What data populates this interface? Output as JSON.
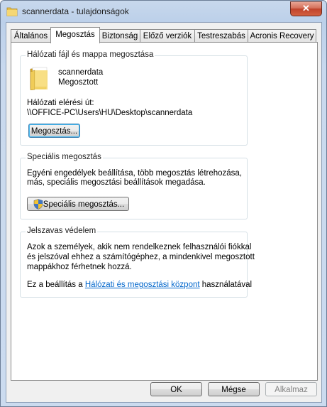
{
  "window": {
    "title": "scannerdata - tulajdonságok",
    "close_label": "✕"
  },
  "tabs": [
    {
      "label": "Általános"
    },
    {
      "label": "Megosztás",
      "active": true
    },
    {
      "label": "Biztonság"
    },
    {
      "label": "Előző verziók"
    },
    {
      "label": "Testreszabás"
    },
    {
      "label": "Acronis Recovery"
    }
  ],
  "network_sharing": {
    "title": "Hálózati fájl és mappa megosztása",
    "folder_name": "scannerdata",
    "status": "Megosztott",
    "path_label": "Hálózati elérési út:",
    "path": "\\\\OFFICE-PC\\Users\\HU\\Desktop\\scannerdata",
    "share_button": "Megosztás..."
  },
  "advanced_sharing": {
    "title": "Speciális megosztás",
    "description_line1": "Egyéni engedélyek beállítása, több megosztás létrehozása,",
    "description_line2": "más, speciális megosztási beállítások megadása.",
    "button": "Speciális megosztás..."
  },
  "password_protection": {
    "title": "Jelszavas védelem",
    "line1": "Azok a személyek, akik nem rendelkeznek felhasználói fiókkal",
    "line2": "és jelszóval ehhez a számítógéphez, a mindenkivel megosztott",
    "line3": "mappákhoz férhetnek hozzá.",
    "settings_prefix": "Ez a beállítás a",
    "settings_link": "Hálózati és megosztási központ",
    "settings_suffix": "használatával"
  },
  "footer": {
    "ok": "OK",
    "cancel": "Mégse",
    "apply": "Alkalmaz"
  }
}
